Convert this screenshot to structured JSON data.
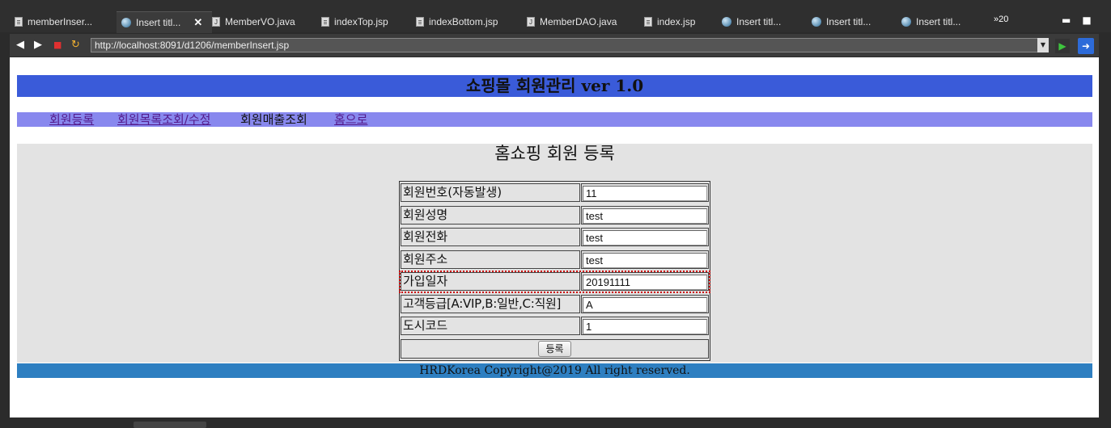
{
  "tabs": [
    {
      "label": "memberInser...",
      "icon": "doc-icon"
    },
    {
      "label": "Insert titl...",
      "icon": "globe-icon",
      "active": true
    },
    {
      "label": "MemberVO.java",
      "icon": "java-file-icon"
    },
    {
      "label": "indexTop.jsp",
      "icon": "doc-icon"
    },
    {
      "label": "indexBottom.jsp",
      "icon": "doc-icon"
    },
    {
      "label": "MemberDAO.java",
      "icon": "java-file-icon"
    },
    {
      "label": "index.jsp",
      "icon": "doc-icon"
    },
    {
      "label": "Insert titl...",
      "icon": "globe-icon"
    },
    {
      "label": "Insert titl...",
      "icon": "globe-icon"
    },
    {
      "label": "Insert titl...",
      "icon": "globe-icon"
    }
  ],
  "tab_close": "✕",
  "tab_overflow": "»20",
  "window": {
    "minimize": "▬",
    "maximize": "■"
  },
  "nav": {
    "back": "◀",
    "forward": "▶",
    "stop": "■",
    "refresh": "↻",
    "url": "http://localhost:8091/d1206/memberInsert.jsp",
    "go": "▶"
  },
  "page": {
    "header": "쇼핑몰 회원관리 ver 1.0",
    "menu": [
      "회원등록",
      "회원목록조회/수정",
      "회원매출조회",
      "홈으로"
    ],
    "section_title": "홈쇼핑 회원 등록",
    "fields": [
      {
        "label": "회원번호(자동발생)",
        "value": "11"
      },
      {
        "label": "회원성명",
        "value": "test"
      },
      {
        "label": "회원전화",
        "value": "test"
      },
      {
        "label": "회원주소",
        "value": "test"
      },
      {
        "label": "가입일자",
        "value": "20191111"
      },
      {
        "label": "고객등급[A:VIP,B:일반,C:직원]",
        "value": "A"
      },
      {
        "label": "도시코드",
        "value": "1"
      }
    ],
    "submit": "등록",
    "footer": "HRDKorea Copyright@2019 All right reserved."
  },
  "colors": {
    "header_bg": "#3a5bd9",
    "menu_bg": "#8888ee",
    "section_bg": "#e3e3e3",
    "footer_bg": "#2e7fc1",
    "focus_outline": "#cc0000"
  }
}
